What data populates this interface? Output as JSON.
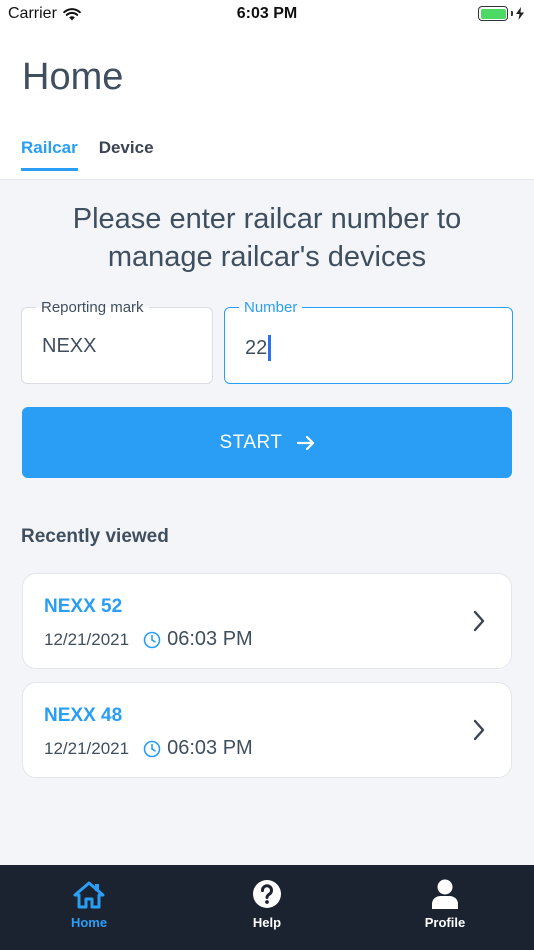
{
  "status_bar": {
    "carrier": "Carrier",
    "time": "6:03 PM"
  },
  "header": {
    "title": "Home",
    "tabs": [
      {
        "label": "Railcar",
        "active": true
      },
      {
        "label": "Device",
        "active": false
      }
    ]
  },
  "form": {
    "prompt_line1": "Please enter railcar number to",
    "prompt_line2": "manage railcar's devices",
    "reporting_mark": {
      "label": "Reporting mark",
      "value": "NEXX"
    },
    "number": {
      "label": "Number",
      "value": "22"
    },
    "start_label": "START"
  },
  "recent": {
    "title": "Recently viewed",
    "items": [
      {
        "name": "NEXX 52",
        "date": "12/21/2021",
        "time": "06:03 PM"
      },
      {
        "name": "NEXX 48",
        "date": "12/21/2021",
        "time": "06:03 PM"
      }
    ]
  },
  "bottom_nav": {
    "items": [
      {
        "label": "Home",
        "icon": "home-icon",
        "active": true
      },
      {
        "label": "Help",
        "icon": "help-icon",
        "active": false
      },
      {
        "label": "Profile",
        "icon": "profile-icon",
        "active": false
      }
    ]
  },
  "colors": {
    "accent": "#2a9ef5",
    "text": "#3f4f5f",
    "background": "#f4f5f9",
    "nav_background": "#1c2330",
    "battery": "#4cd964"
  }
}
